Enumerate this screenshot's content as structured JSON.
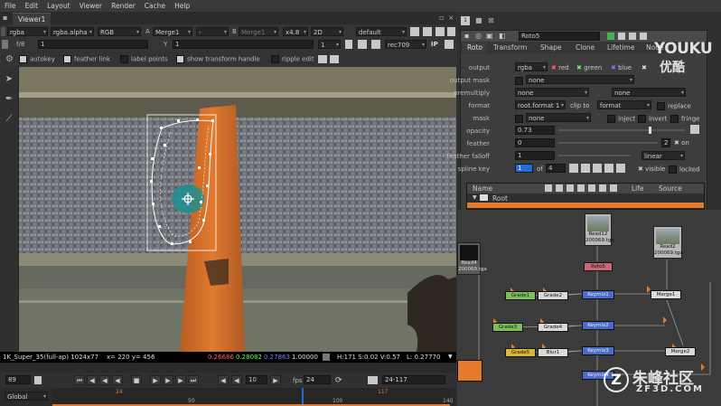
{
  "menu": [
    "File",
    "Edit",
    "Layout",
    "Viewer",
    "Render",
    "Cache",
    "Help"
  ],
  "viewer_tab": "Viewer1",
  "viewer_controls": {
    "layers": "rgba",
    "alpha": "rgba.alpha",
    "colorspace": "RGB",
    "a_label": "A",
    "a_input": "Merge1",
    "a_extra": "-",
    "b_label": "B",
    "b_input": "Merge1",
    "zoom": "x4.8",
    "view": "2D",
    "lut": "default",
    "fstop": "f/8",
    "gain": "1",
    "y_label": "Y",
    "gamma": "1",
    "frame_field": "1",
    "display": "rec709",
    "ip": "IP"
  },
  "roto_toolbar": {
    "autokey": "autokey",
    "feather_link": "feather link",
    "label_points": "label points",
    "show_transform": "show transform handle",
    "ripple_edit": "ripple edit"
  },
  "infobar": {
    "format": "1K_Super_35(full-ap) 1024x77",
    "coords": "x= 220 y= 456",
    "r": "0.26686",
    "g": "0.28082",
    "b": "0.27863",
    "a": "1.00000",
    "hsv": "H:171 S:0.02 V:0.57",
    "lum": "L: 0.27770"
  },
  "playback": {
    "frame": "89",
    "increment": "10",
    "fps_label": "fps",
    "fps": "24",
    "range": "24-117",
    "global": "Global"
  },
  "timeline": {
    "ticks": [
      "24",
      "50",
      "100",
      "117",
      "140"
    ]
  },
  "props_header": {
    "count": "1",
    "node_name": "Roto5"
  },
  "props_tabs": [
    "Roto",
    "Transform",
    "Shape",
    "Clone",
    "Lifetime",
    "Node"
  ],
  "props": {
    "output_label": "output",
    "output": "rgba",
    "red": "red",
    "green": "green",
    "blue": "blue",
    "output_mask_label": "output mask",
    "output_mask": "none",
    "premult_label": "premultiply",
    "premult": "none",
    "premult2": "none",
    "format_label": "format",
    "format": "root.format 1",
    "clip_to": "clip to",
    "clip_val": "format",
    "replace": "replace",
    "mask_label": "mask",
    "mask": "none",
    "inject": "inject",
    "invert": "invert",
    "fringe": "fringe",
    "opacity_label": "opacity",
    "opacity": "0.73",
    "feather_label": "feather",
    "feather": "0",
    "feather_val": "2",
    "on": "on",
    "falloff_label": "feather falloff",
    "falloff": "1",
    "falloff_type": "linear",
    "spline_label": "spline key",
    "spline_key": "1",
    "of": "of",
    "spline_total": "4",
    "visible": "visible",
    "locked": "locked"
  },
  "curves_table": {
    "headers": [
      "Name",
      "Life",
      "Source"
    ],
    "root": "Root"
  },
  "dag_nodes": {
    "read12": "Read12",
    "read12_sub": "200069.tga",
    "read2": "Read2",
    "read2_sub": "200069.tga",
    "read4": "Read4",
    "read4_sub": "200069.tga",
    "roto": "Roto5",
    "k1": "Keymix1",
    "k2": "Keymix2",
    "k3": "Keymix3",
    "k4": "Keymix4",
    "g1": "Grade1",
    "g2": "Grade2",
    "g3": "Grade3",
    "g4": "Grade4",
    "g5": "Grade5",
    "blur": "Blur1",
    "m1": "Merge1",
    "m2": "Merge2"
  },
  "watermark": {
    "youku": "YOUKU",
    "youku_cn": "优酷",
    "zf": "朱峰社区",
    "zf_url": "ZF3D.COM"
  },
  "colors": {
    "accent": "#e57a2c",
    "selection": "#1e6fd8",
    "red": "#ff6060",
    "green": "#60ff60",
    "blue": "#7080ff"
  }
}
